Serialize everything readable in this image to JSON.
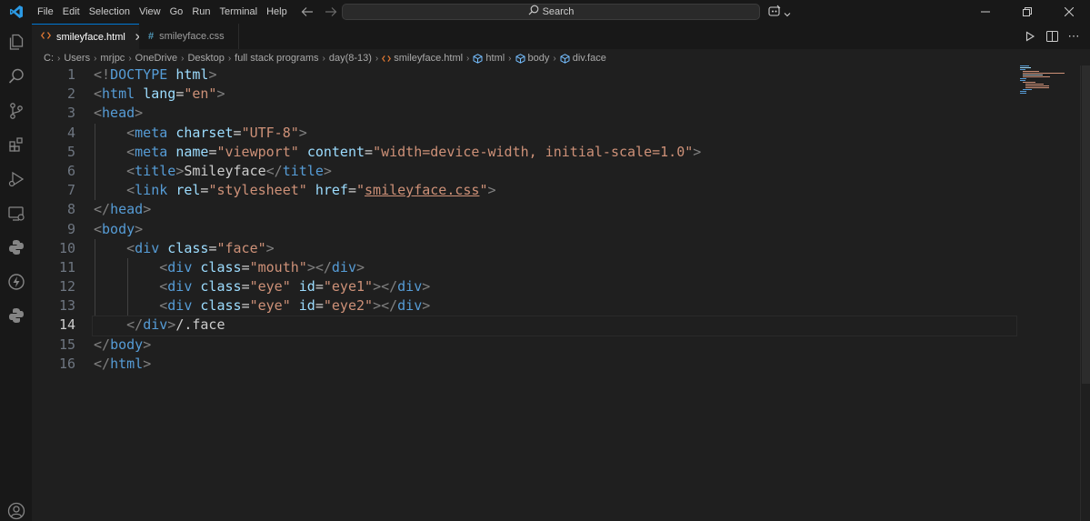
{
  "menu": [
    "File",
    "Edit",
    "Selection",
    "View",
    "Go",
    "Run",
    "Terminal",
    "Help"
  ],
  "search": {
    "label": "Search"
  },
  "tabs": [
    {
      "label": "smileyface.html",
      "icon": "html-file-icon",
      "active": true
    },
    {
      "label": "smileyface.css",
      "icon": "css-file-icon",
      "active": false
    }
  ],
  "breadcrumb": [
    "C:",
    "Users",
    "mrjpc",
    "OneDrive",
    "Desktop",
    "full stack programs",
    "day(8-13)",
    "smileyface.html",
    "html",
    "body",
    "div.face"
  ],
  "editor": {
    "current_line": 14,
    "line_numbers": [
      "1",
      "2",
      "3",
      "4",
      "5",
      "6",
      "7",
      "8",
      "9",
      "10",
      "11",
      "12",
      "13",
      "14",
      "15",
      "16"
    ]
  },
  "icons": {
    "activity": [
      "explorer-icon",
      "search-icon",
      "source-control-icon",
      "extensions-icon",
      "run-debug-icon",
      "remote-explorer-icon",
      "python-icon",
      "thunder-icon",
      "python-env-icon",
      "account-icon"
    ]
  },
  "colors": {
    "accent": "#0078d4",
    "tag": "#569cd6",
    "attribute": "#9cdcfe",
    "string": "#ce9178",
    "bracket": "#808080"
  }
}
